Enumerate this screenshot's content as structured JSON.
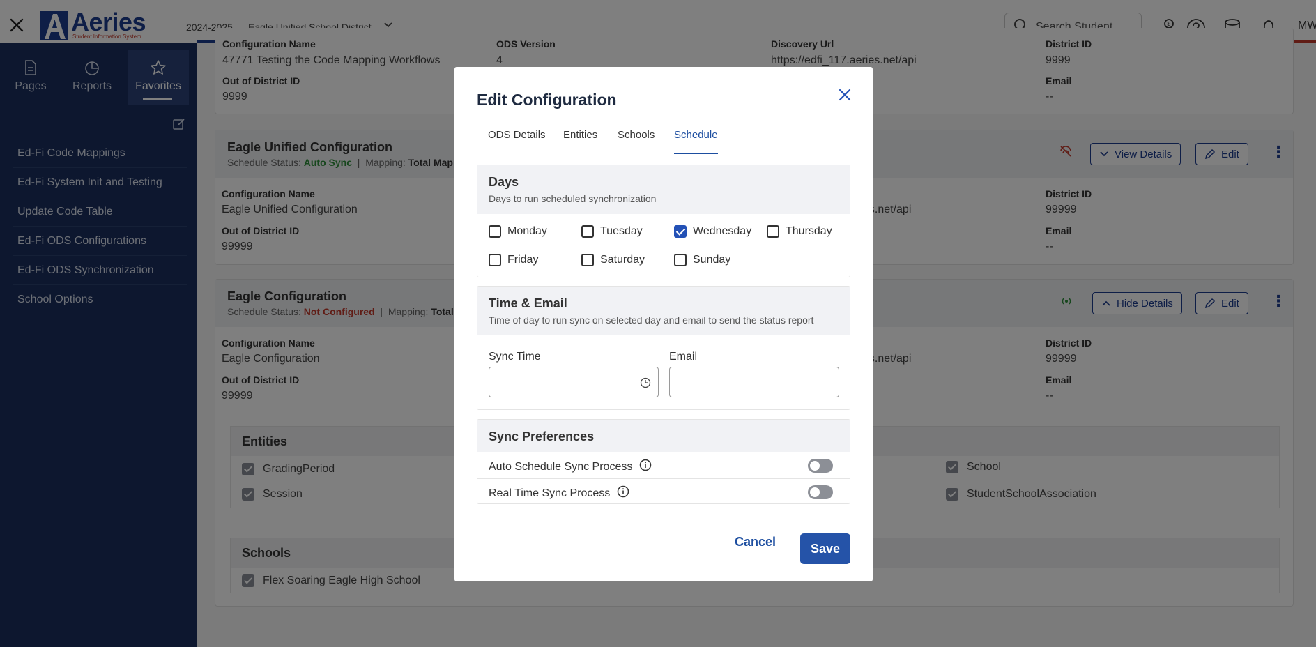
{
  "topbar": {
    "logo_name": "Aeries",
    "logo_sub": "Student Information System",
    "year": "2024-2025",
    "district": "Eagle Unified School District",
    "search_placeholder": "Search Student",
    "avatar": "MW"
  },
  "sidebar": {
    "tabs": [
      {
        "label": "Pages",
        "icon": "document-icon"
      },
      {
        "label": "Reports",
        "icon": "pie-chart-icon"
      },
      {
        "label": "Favorites",
        "icon": "star-icon"
      }
    ],
    "items": [
      {
        "label": "Ed-Fi Code Mappings"
      },
      {
        "label": "Ed-Fi System Init and Testing"
      },
      {
        "label": "Update Code Table"
      },
      {
        "label": "Ed-Fi ODS Configurations"
      },
      {
        "label": "Ed-Fi ODS Synchronization"
      },
      {
        "label": "School Options"
      }
    ]
  },
  "background": {
    "card0": {
      "config_name_label": "Configuration Name",
      "config_name": "47771 Testing the Code Mapping Workflows",
      "ods_version_label": "ODS Version",
      "ods_version": "4",
      "discovery_label": "Discovery Url",
      "discovery": "https://edfi_117.aeries.net/api",
      "district_id_label": "District ID",
      "district_id": "9999",
      "out_district_label": "Out of District ID",
      "out_district": "9999",
      "email_label": "Email",
      "email": "--"
    },
    "card1": {
      "title": "Eagle Unified Configuration",
      "status_prefix": "Schedule Status:",
      "status": "Auto Sync",
      "mapping_prefix": "Mapping:",
      "mapping": "Total Mapp",
      "view_details": "View Details",
      "edit": "Edit",
      "config_name_label": "Configuration Name",
      "config_name": "Eagle Unified Configuration",
      "url_tail": "es.net/api",
      "district_id_label": "District ID",
      "district_id": "99999",
      "out_district_label": "Out of District ID",
      "out_district": "99999",
      "email_label": "Email",
      "email": "--"
    },
    "card2": {
      "title": "Eagle Configuration",
      "status_prefix": "Schedule Status:",
      "status": "Not Configured",
      "mapping_prefix": "Mapping:",
      "mapping": "Total I",
      "hide_details": "Hide Details",
      "edit": "Edit",
      "config_name_label": "Configuration Name",
      "config_name": "Eagle Configuration",
      "url_tail": "es.net/api",
      "district_id_label": "District ID",
      "district_id": "99999",
      "out_district_label": "Out of District ID",
      "out_district": "99999",
      "email_label": "Email",
      "email": "--",
      "entities_title": "Entities",
      "entities": [
        "GradingPeriod",
        "Session",
        "School",
        "StudentSchoolAssociation"
      ],
      "schools_title": "Schools",
      "schools": [
        "Flex Soaring Eagle High School"
      ]
    }
  },
  "modal": {
    "title": "Edit Configuration",
    "tabs": [
      "ODS Details",
      "Entities",
      "Schools",
      "Schedule"
    ],
    "active_tab": "Schedule",
    "days": {
      "title": "Days",
      "desc": "Days to run scheduled synchronization",
      "items": [
        {
          "label": "Monday",
          "checked": false
        },
        {
          "label": "Tuesday",
          "checked": false
        },
        {
          "label": "Wednesday",
          "checked": true
        },
        {
          "label": "Thursday",
          "checked": false
        },
        {
          "label": "Friday",
          "checked": false
        },
        {
          "label": "Saturday",
          "checked": false
        },
        {
          "label": "Sunday",
          "checked": false
        }
      ]
    },
    "time_email": {
      "title": "Time & Email",
      "desc": "Time of day to run sync on selected day and email to send the status report",
      "sync_time_label": "Sync Time",
      "sync_time_value": "",
      "email_label": "Email",
      "email_value": ""
    },
    "prefs": {
      "title": "Sync Preferences",
      "auto_label": "Auto Schedule Sync Process",
      "auto_on": false,
      "realtime_label": "Real Time Sync Process",
      "realtime_on": false
    },
    "cancel": "Cancel",
    "save": "Save"
  },
  "colors": {
    "brand": "#1d3c8f",
    "sidebar": "#1b2f5e",
    "primary_button": "#2553a8",
    "status_green": "#2f8f3b",
    "status_red": "#c0392b"
  }
}
